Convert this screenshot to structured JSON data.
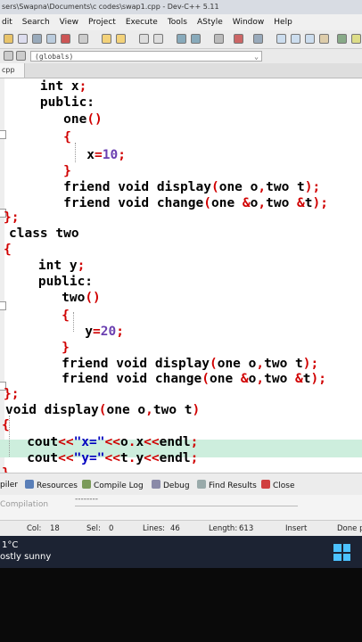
{
  "window": {
    "title": "sers\\Swapna\\Documents\\c codes\\swap1.cpp - Dev-C++ 5.11"
  },
  "menu": [
    "dit",
    "Search",
    "View",
    "Project",
    "Execute",
    "Tools",
    "AStyle",
    "Window",
    "Help"
  ],
  "scope_selector": {
    "value": "(globals)"
  },
  "file_tab": {
    "label": "cpp"
  },
  "code_lines": [
    "    int x;",
    "    public:",
    "       one()",
    "       {",
    "          x=10;",
    "       }",
    "       friend void display(one o,two t);",
    "       friend void change(one &o,two &t);",
    "};",
    "class two",
    "{",
    "    int y;",
    "    public:",
    "       two()",
    "       {",
    "          y=20;",
    "       }",
    "       friend void display(one o,two t);",
    "       friend void change(one &o,two &t);",
    "};",
    "void display(one o,two t)",
    "{",
    "   cout<<\"x=\"<<o.x<<endl;",
    "   cout<<\"y=\"<<t.y<<endl;",
    "}"
  ],
  "bottom_tabs": {
    "compiler": "piler",
    "resources": "Resources",
    "compile_log": "Compile Log",
    "debug": "Debug",
    "find_results": "Find Results",
    "close": "Close"
  },
  "compile_panel": {
    "label": "Compilation",
    "progress_text": "--------"
  },
  "status": {
    "col_label": "Col:",
    "col_value": "18",
    "sel_label": "Sel:",
    "sel_value": "0",
    "lines_label": "Lines:",
    "lines_value": "46",
    "length_label": "Length:",
    "length_value": "613",
    "mode": "Insert",
    "state": "Done p"
  },
  "taskbar": {
    "temperature": "1°C",
    "weather": "ostly sunny"
  },
  "colors": {
    "operator": "#d00000",
    "number": "#6a3fb0",
    "string": "#0000c0",
    "current_line": "#cdeedd",
    "taskbar": "#1c2333",
    "windows_logo": "#4cc2ff"
  }
}
